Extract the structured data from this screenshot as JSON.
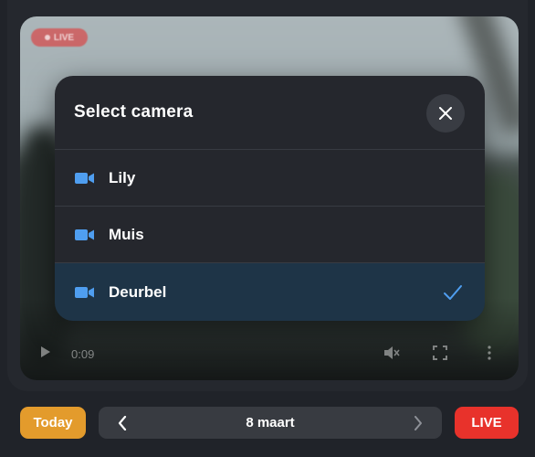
{
  "video": {
    "live_badge": "LIVE",
    "time": "0:09"
  },
  "modal": {
    "title": "Select camera",
    "cameras": [
      {
        "label": "Lily",
        "selected": false
      },
      {
        "label": "Muis",
        "selected": false
      },
      {
        "label": "Deurbel",
        "selected": true
      }
    ]
  },
  "bottom_bar": {
    "today_label": "Today",
    "date_label": "8 maart",
    "live_label": "LIVE"
  },
  "colors": {
    "accent_blue": "#4f9ef0",
    "today_orange": "#e39b2c",
    "live_red": "#e8322b",
    "selected_row": "#1e3447"
  },
  "icons": {
    "close": "close-icon",
    "camera": "video-camera-icon",
    "check": "checkmark-icon",
    "prev": "chevron-left-icon",
    "next": "chevron-right-icon",
    "play": "play-icon",
    "volume": "volume-muted-icon",
    "fullscreen": "fullscreen-icon",
    "more": "more-vertical-icon"
  }
}
